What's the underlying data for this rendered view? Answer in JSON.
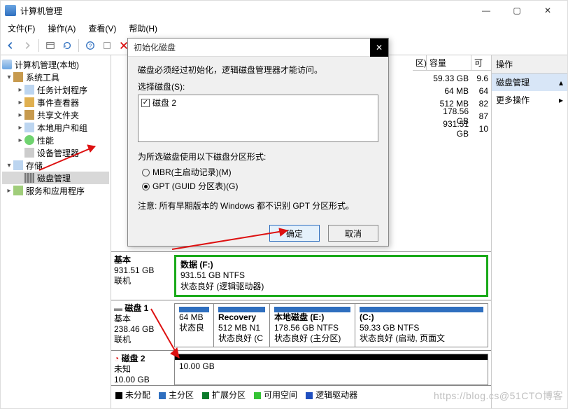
{
  "window": {
    "title": "计算机管理"
  },
  "window_controls": {
    "min": "—",
    "max": "▢",
    "close": "✕"
  },
  "menubar": [
    "文件(F)",
    "操作(A)",
    "查看(V)",
    "帮助(H)"
  ],
  "tree": {
    "root": "计算机管理(本地)",
    "sys_tools": "系统工具",
    "sys_children": [
      "任务计划程序",
      "事件查看器",
      "共享文件夹",
      "本地用户和组",
      "性能",
      "设备管理器"
    ],
    "storage": "存储",
    "disk_mgmt": "磁盘管理",
    "services": "服务和应用程序"
  },
  "vol_header": {
    "capacity": "容量",
    "free": "可"
  },
  "vol_rows_cap": [
    "59.33 GB",
    "64 MB",
    "512 MB",
    "178.56 GB",
    "931.51 GB"
  ],
  "vol_rows_free": [
    "9.6",
    "64",
    "82",
    "87",
    "10"
  ],
  "vol_layout_badge": "区)",
  "disk_f": {
    "name_line": "基本",
    "size": "931.51 GB",
    "status": "联机",
    "vol_label": "数据 (F:)",
    "vol_size": "931.51 GB NTFS",
    "vol_status": "状态良好 (逻辑驱动器)"
  },
  "disk1": {
    "title": "磁盘 1",
    "type": "基本",
    "size": "238.46 GB",
    "status": "联机",
    "p1_size": "64 MB",
    "p1_status": "状态良",
    "p2_name": "Recovery",
    "p2_size": "512 MB N1",
    "p2_status": "状态良好 (C",
    "p3_name": "本地磁盘  (E:)",
    "p3_size": "178.56 GB NTFS",
    "p3_status": "状态良好 (主分区)",
    "p4_name": "(C:)",
    "p4_size": "59.33 GB NTFS",
    "p4_status": "状态良好 (启动, 页面文"
  },
  "disk2": {
    "title": "磁盘 2",
    "type": "未知",
    "size": "10.00 GB",
    "vol_size": "10.00 GB"
  },
  "legend": {
    "unalloc": "未分配",
    "primary": "主分区",
    "ext": "扩展分区",
    "free": "可用空间",
    "logical": "逻辑驱动器"
  },
  "actions": {
    "header": "操作",
    "section": "磁盘管理",
    "more": "更多操作",
    "arrow": "▸"
  },
  "dialog": {
    "title": "初始化磁盘",
    "msg": "磁盘必须经过初始化，逻辑磁盘管理器才能访问。",
    "select_label": "选择磁盘(S):",
    "disk_item": "磁盘 2",
    "style_label": "为所选磁盘使用以下磁盘分区形式:",
    "mbr": "MBR(主启动记录)(M)",
    "gpt": "GPT (GUID 分区表)(G)",
    "note": "注意: 所有早期版本的 Windows 都不识别 GPT 分区形式。",
    "ok": "确定",
    "cancel": "取消",
    "close_x": "✕",
    "check": "✓"
  },
  "watermark": "https://blog.cs@51CTO博客"
}
